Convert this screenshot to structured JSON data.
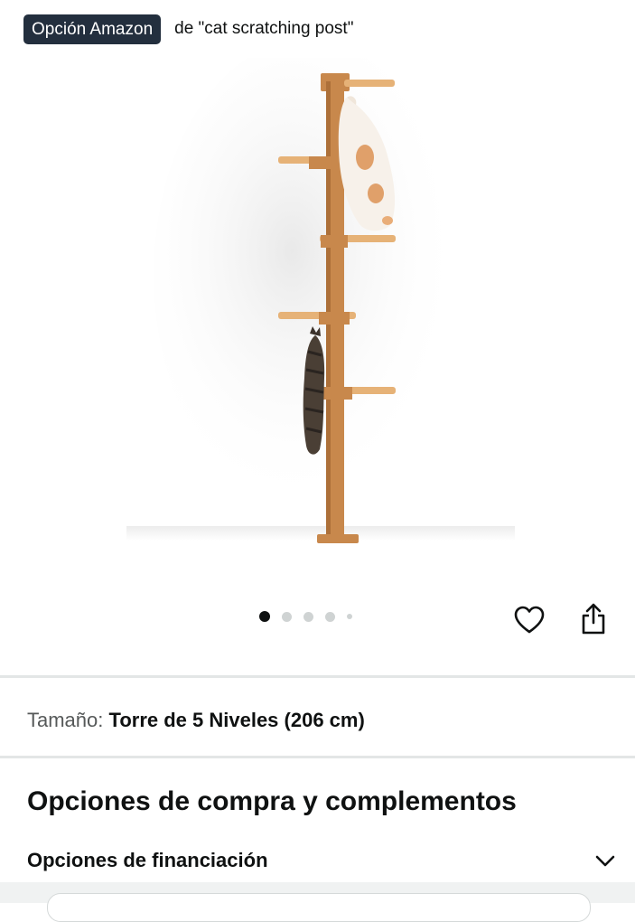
{
  "badge": {
    "label": "Opción Amazon",
    "query": "de \"cat scratching post\""
  },
  "product": {
    "image_icon": "cat-tree-image",
    "carousel_dots": 5,
    "active_dot": 0
  },
  "actions": {
    "favorite_icon": "heart-icon",
    "share_icon": "share-icon"
  },
  "size": {
    "label": "Tamaño:",
    "value": "Torre de 5 Niveles (206 cm)"
  },
  "purchase": {
    "heading": "Opciones de compra y complementos",
    "financing_label": "Opciones de financiación",
    "chevron_icon": "chevron-down-icon"
  },
  "colors": {
    "badge_bg": "#232f3e",
    "pole": "#c8884c",
    "divider": "#e3e6e6"
  }
}
